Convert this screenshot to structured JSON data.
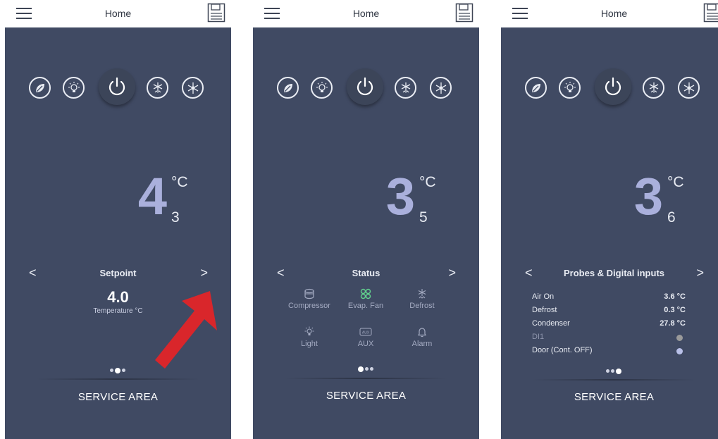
{
  "colors": {
    "screen_bg": "#404a63",
    "header_bg": "#ffffff",
    "temp_digit": "#aab0dc",
    "active_green": "#62d08e",
    "arrow_red": "#d9262b",
    "dot_gray": "#9a9a9a",
    "dot_blue": "#b9c0e8"
  },
  "header": {
    "title": "Home",
    "menu_icon": "hamburger-menu-icon",
    "save_icon": "floppy-save-icon"
  },
  "mode_buttons": [
    "eco-leaf-icon",
    "light-bulb-icon",
    "power-icon",
    "defrost-snowflake-icon",
    "snowflake-fan-icon"
  ],
  "screens": [
    {
      "temperature": {
        "integer": "4",
        "decimal": "3",
        "unit": "°C"
      },
      "nav": {
        "prev": "<",
        "title": "Setpoint",
        "next": ">"
      },
      "setpoint": {
        "value": "4.0",
        "label": "Temperature °C"
      },
      "page_index": 2,
      "service_area": "SERVICE AREA"
    },
    {
      "temperature": {
        "integer": "3",
        "decimal": "5",
        "unit": "°C"
      },
      "nav": {
        "prev": "<",
        "title": "Status",
        "next": ">"
      },
      "status_items": [
        {
          "label": "Compressor",
          "icon": "compressor-icon",
          "active": false
        },
        {
          "label": "Evap. Fan",
          "icon": "fan-icon",
          "active": true
        },
        {
          "label": "Defrost",
          "icon": "defrost-icon",
          "active": false
        },
        {
          "label": "Light",
          "icon": "light-icon",
          "active": false
        },
        {
          "label": "AUX",
          "icon": "aux-icon",
          "active": false
        },
        {
          "label": "Alarm",
          "icon": "bell-icon",
          "active": false
        }
      ],
      "page_index": 1,
      "service_area": "SERVICE AREA"
    },
    {
      "temperature": {
        "integer": "3",
        "decimal": "6",
        "unit": "°C"
      },
      "nav": {
        "prev": "<",
        "title": "Probes & Digital inputs",
        "next": ">"
      },
      "probes": [
        {
          "name": "Air On",
          "value": "3.6 °C"
        },
        {
          "name": "Defrost",
          "value": "0.3 °C"
        },
        {
          "name": "Condenser",
          "value": "27.8 °C"
        }
      ],
      "digital_inputs": [
        {
          "name": "DI1",
          "state": "gray"
        },
        {
          "name": "Door (Cont. OFF)",
          "state": "blue"
        }
      ],
      "page_index": 3,
      "service_area": "SERVICE AREA"
    }
  ]
}
